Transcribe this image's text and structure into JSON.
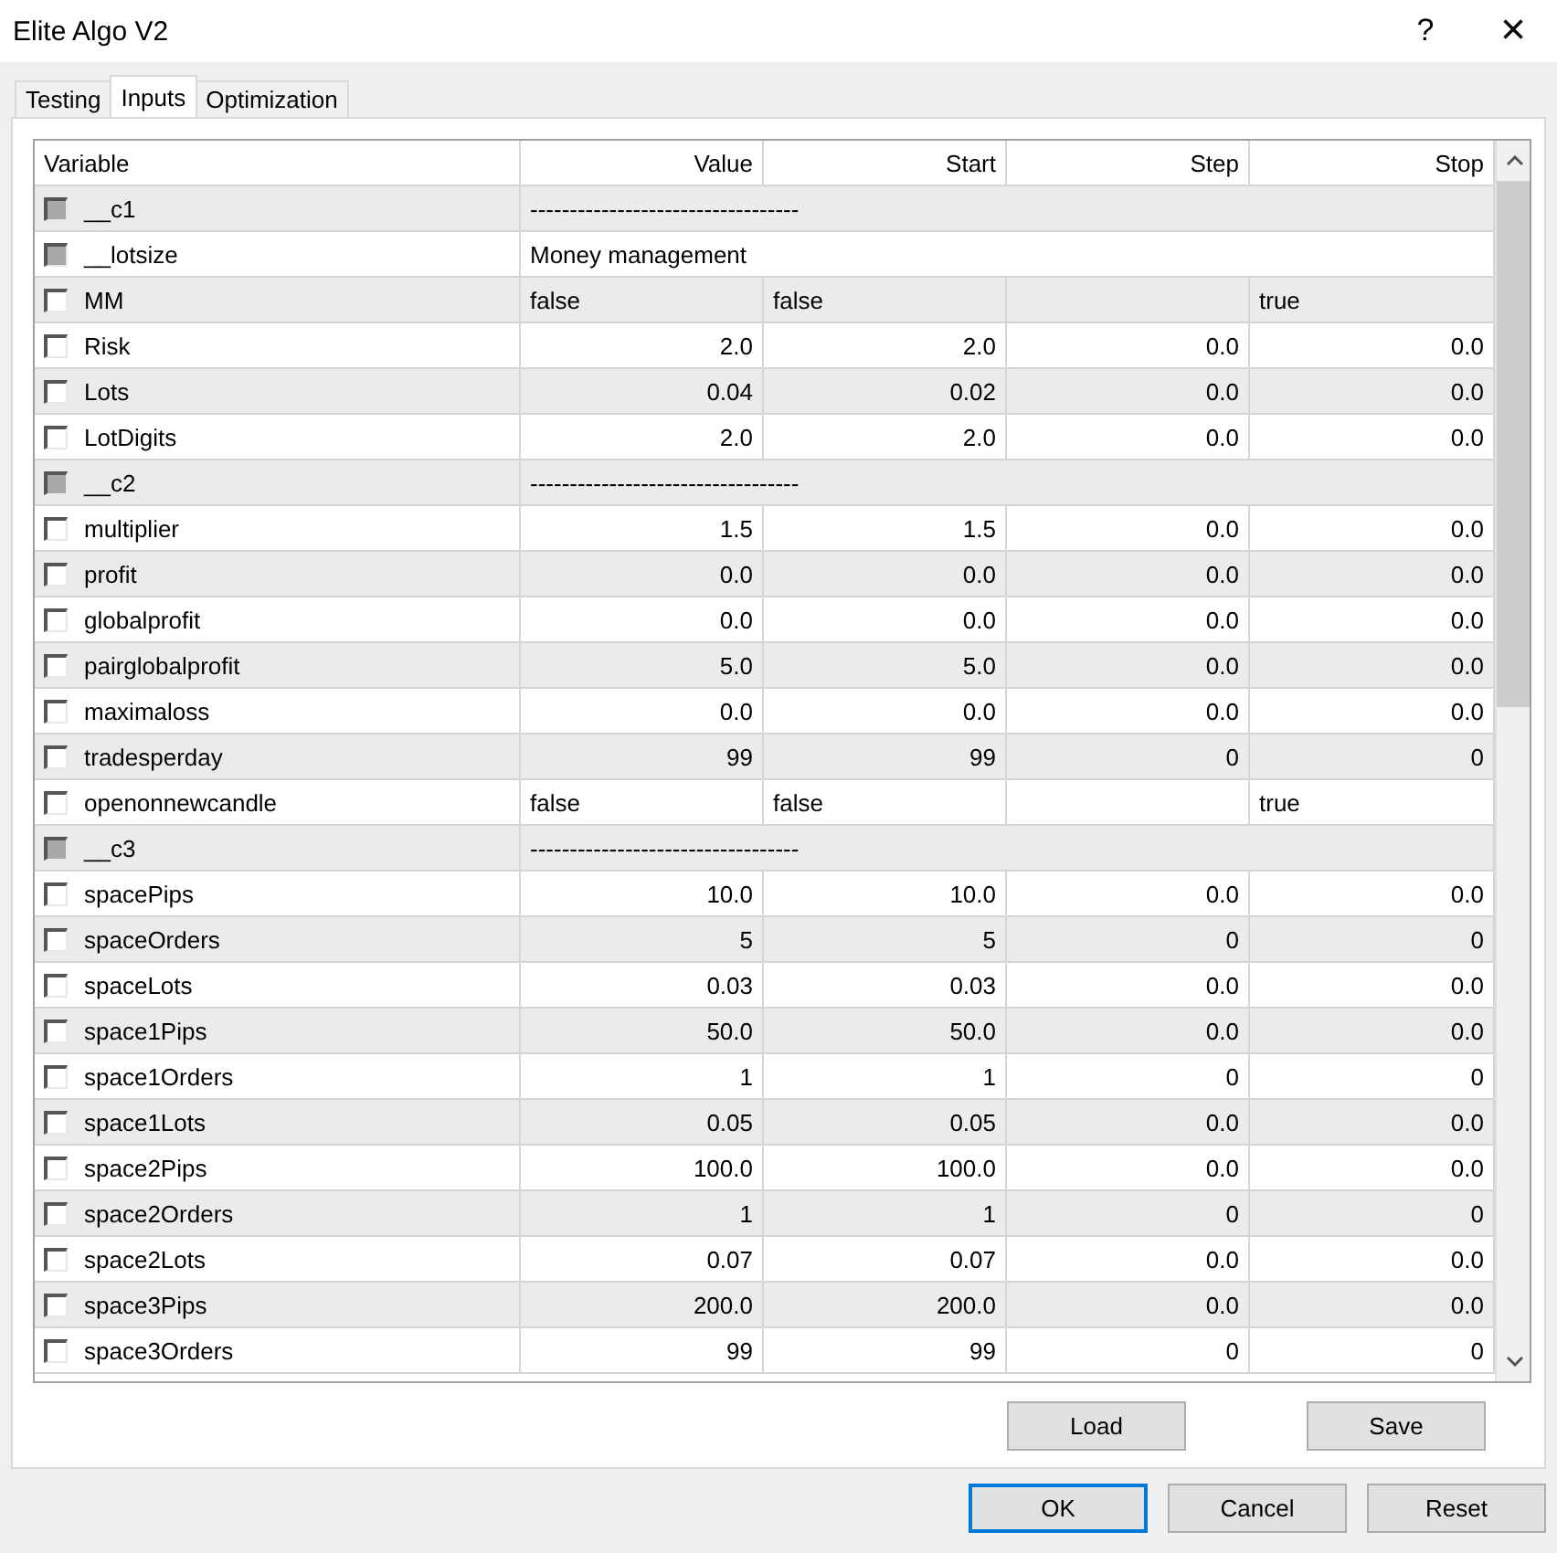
{
  "window": {
    "title": "Elite Algo V2",
    "help": "?",
    "close": "×"
  },
  "tabs": [
    {
      "label": "Testing",
      "selected": false
    },
    {
      "label": "Inputs",
      "selected": true
    },
    {
      "label": "Optimization",
      "selected": false
    }
  ],
  "table": {
    "columns": [
      "Variable",
      "Value",
      "Start",
      "Step",
      "Stop"
    ],
    "rows": [
      {
        "kind": "separator",
        "name": "__c1",
        "checked": false,
        "disabled": true,
        "value": "----------------------------------"
      },
      {
        "kind": "separator",
        "name": "__lotsize",
        "checked": false,
        "disabled": true,
        "value": "Money management"
      },
      {
        "kind": "bool",
        "name": "MM",
        "checked": false,
        "disabled": false,
        "value": "false",
        "start": "false",
        "stop": "true"
      },
      {
        "kind": "number",
        "name": "Risk",
        "checked": false,
        "disabled": false,
        "value": "2.0",
        "start": "2.0",
        "step": "0.0",
        "stop": "0.0"
      },
      {
        "kind": "number",
        "name": "Lots",
        "checked": false,
        "disabled": false,
        "value": "0.04",
        "start": "0.02",
        "step": "0.0",
        "stop": "0.0"
      },
      {
        "kind": "number",
        "name": "LotDigits",
        "checked": false,
        "disabled": false,
        "value": "2.0",
        "start": "2.0",
        "step": "0.0",
        "stop": "0.0"
      },
      {
        "kind": "separator",
        "name": "__c2",
        "checked": false,
        "disabled": true,
        "value": "----------------------------------"
      },
      {
        "kind": "number",
        "name": "multiplier",
        "checked": false,
        "disabled": false,
        "value": "1.5",
        "start": "1.5",
        "step": "0.0",
        "stop": "0.0"
      },
      {
        "kind": "number",
        "name": "profit",
        "checked": false,
        "disabled": false,
        "value": "0.0",
        "start": "0.0",
        "step": "0.0",
        "stop": "0.0"
      },
      {
        "kind": "number",
        "name": "globalprofit",
        "checked": false,
        "disabled": false,
        "value": "0.0",
        "start": "0.0",
        "step": "0.0",
        "stop": "0.0"
      },
      {
        "kind": "number",
        "name": "pairglobalprofit",
        "checked": false,
        "disabled": false,
        "value": "5.0",
        "start": "5.0",
        "step": "0.0",
        "stop": "0.0"
      },
      {
        "kind": "number",
        "name": "maximaloss",
        "checked": false,
        "disabled": false,
        "value": "0.0",
        "start": "0.0",
        "step": "0.0",
        "stop": "0.0"
      },
      {
        "kind": "number",
        "name": "tradesperday",
        "checked": false,
        "disabled": false,
        "value": "99",
        "start": "99",
        "step": "0",
        "stop": "0"
      },
      {
        "kind": "bool",
        "name": "openonnewcandle",
        "checked": false,
        "disabled": false,
        "value": "false",
        "start": "false",
        "stop": "true"
      },
      {
        "kind": "separator",
        "name": "__c3",
        "checked": false,
        "disabled": true,
        "value": "----------------------------------"
      },
      {
        "kind": "number",
        "name": "spacePips",
        "checked": false,
        "disabled": false,
        "value": "10.0",
        "start": "10.0",
        "step": "0.0",
        "stop": "0.0"
      },
      {
        "kind": "number",
        "name": "spaceOrders",
        "checked": false,
        "disabled": false,
        "value": "5",
        "start": "5",
        "step": "0",
        "stop": "0"
      },
      {
        "kind": "number",
        "name": "spaceLots",
        "checked": false,
        "disabled": false,
        "value": "0.03",
        "start": "0.03",
        "step": "0.0",
        "stop": "0.0"
      },
      {
        "kind": "number",
        "name": "space1Pips",
        "checked": false,
        "disabled": false,
        "value": "50.0",
        "start": "50.0",
        "step": "0.0",
        "stop": "0.0"
      },
      {
        "kind": "number",
        "name": "space1Orders",
        "checked": false,
        "disabled": false,
        "value": "1",
        "start": "1",
        "step": "0",
        "stop": "0"
      },
      {
        "kind": "number",
        "name": "space1Lots",
        "checked": false,
        "disabled": false,
        "value": "0.05",
        "start": "0.05",
        "step": "0.0",
        "stop": "0.0"
      },
      {
        "kind": "number",
        "name": "space2Pips",
        "checked": false,
        "disabled": false,
        "value": "100.0",
        "start": "100.0",
        "step": "0.0",
        "stop": "0.0"
      },
      {
        "kind": "number",
        "name": "space2Orders",
        "checked": false,
        "disabled": false,
        "value": "1",
        "start": "1",
        "step": "0",
        "stop": "0"
      },
      {
        "kind": "number",
        "name": "space2Lots",
        "checked": false,
        "disabled": false,
        "value": "0.07",
        "start": "0.07",
        "step": "0.0",
        "stop": "0.0"
      },
      {
        "kind": "number",
        "name": "space3Pips",
        "checked": false,
        "disabled": false,
        "value": "200.0",
        "start": "200.0",
        "step": "0.0",
        "stop": "0.0"
      },
      {
        "kind": "number",
        "name": "space3Orders",
        "checked": false,
        "disabled": false,
        "value": "99",
        "start": "99",
        "step": "0",
        "stop": "0"
      }
    ]
  },
  "panel_buttons": [
    "Load",
    "Save"
  ],
  "buttons": [
    {
      "label": "OK",
      "default": true
    },
    {
      "label": "Cancel",
      "default": false
    },
    {
      "label": "Reset",
      "default": false
    }
  ]
}
